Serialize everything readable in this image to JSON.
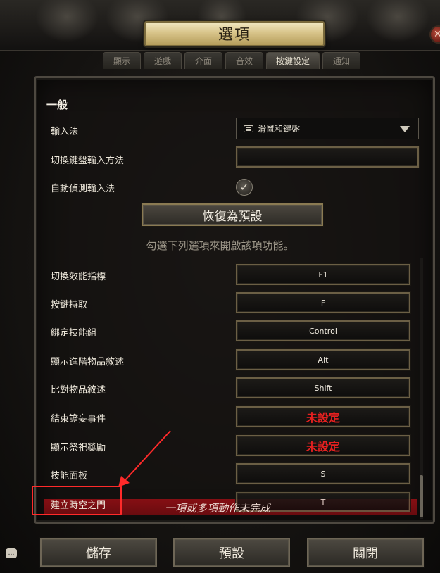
{
  "window": {
    "title": "選項"
  },
  "tabs": [
    {
      "label": "顯示",
      "active": false
    },
    {
      "label": "遊戲",
      "active": false
    },
    {
      "label": "介面",
      "active": false
    },
    {
      "label": "音效",
      "active": false
    },
    {
      "label": "按鍵設定",
      "active": true
    },
    {
      "label": "通知",
      "active": false
    }
  ],
  "general": {
    "section_title": "一般",
    "input_method_label": "輸入法",
    "input_method_value": "滑鼠和鍵盤",
    "switch_keyboard_label": "切換鍵盤輸入方法",
    "switch_keyboard_value": "",
    "auto_detect_label": "自動偵測輸入法",
    "auto_detect_checked": true,
    "restore_default_label": "恢復為預設",
    "hint": "勾選下列選項來開啟該項功能。"
  },
  "bindings": [
    {
      "label": "切換效能指標",
      "key": "F1",
      "unset": false
    },
    {
      "label": "按鍵持取",
      "key": "F",
      "unset": false
    },
    {
      "label": "綁定技能組",
      "key": "Control",
      "unset": false
    },
    {
      "label": "顯示進階物品敘述",
      "key": "Alt",
      "unset": false
    },
    {
      "label": "比對物品敘述",
      "key": "Shift",
      "unset": false
    },
    {
      "label": "結束譫妄事件",
      "key": "未設定",
      "unset": true
    },
    {
      "label": "顯示祭祀獎勵",
      "key": "未設定",
      "unset": true
    },
    {
      "label": "技能面板",
      "key": "S",
      "unset": false
    },
    {
      "label": "建立時空之門",
      "key": "T",
      "unset": false
    }
  ],
  "error_message": "一項或多項動作未完成",
  "footer": {
    "save": "儲存",
    "defaults": "預設",
    "close": "關閉"
  },
  "colors": {
    "unset_red": "#e52020",
    "highlight_red": "#ff2a2a",
    "error_bar": "#8c0f14",
    "gold_plate": "#d8c48a"
  },
  "icons": [
    "keyboard-icon",
    "dropdown-arrow-icon",
    "checkmark-icon",
    "close-icon",
    "chat-icon"
  ]
}
